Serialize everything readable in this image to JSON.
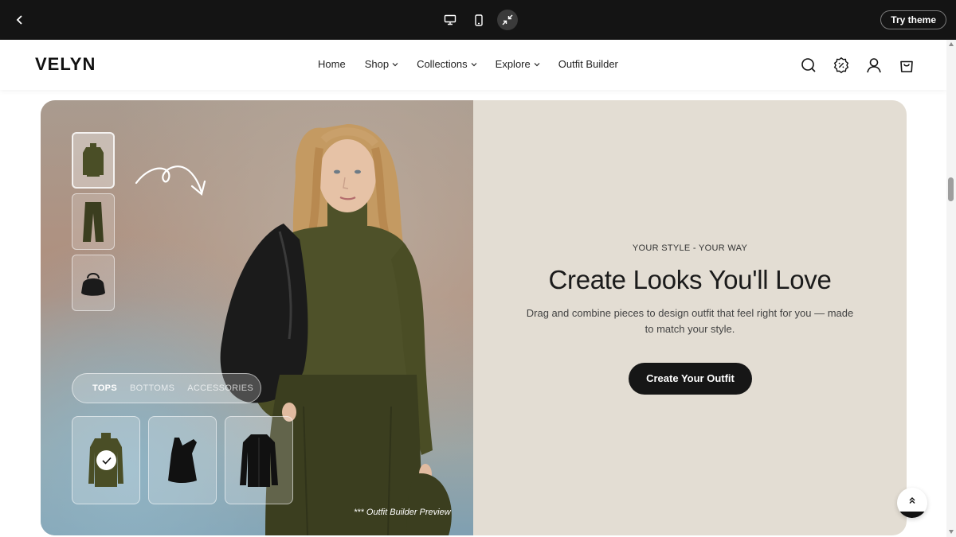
{
  "preview_bar": {
    "try_theme_label": "Try theme",
    "devices": [
      "desktop-icon",
      "mobile-icon",
      "fullscreen-exit-icon"
    ]
  },
  "header": {
    "logo": "VELYN",
    "nav": [
      {
        "label": "Home",
        "dropdown": false
      },
      {
        "label": "Shop",
        "dropdown": true
      },
      {
        "label": "Collections",
        "dropdown": true
      },
      {
        "label": "Explore",
        "dropdown": true
      },
      {
        "label": "Outfit Builder",
        "dropdown": false
      }
    ],
    "icons": [
      "search-icon",
      "discount-badge-icon",
      "account-icon",
      "cart-icon"
    ]
  },
  "builder": {
    "tabs": [
      {
        "label": "TOPS",
        "active": true
      },
      {
        "label": "BOTTOMS",
        "active": false
      },
      {
        "label": "ACCESSORIES",
        "active": false
      }
    ],
    "thumbnails": [
      "turtleneck-top",
      "wide-leg-pants",
      "leather-bag"
    ],
    "products": [
      "olive-turtleneck",
      "black-one-shoulder-top",
      "black-cardigan"
    ],
    "selected_product": "olive-turtleneck",
    "preview_note": "*** Outfit Builder Preview"
  },
  "hero": {
    "eyebrow": "YOUR STYLE - YOUR WAY",
    "headline": "Create Looks You'll Love",
    "description": "Drag and combine pieces to design outfit that feel right for you — made to match your style.",
    "cta_label": "Create Your Outfit"
  },
  "colors": {
    "top_bar": "#141414",
    "hero_panel": "#e3ddd3",
    "cta": "#161616",
    "olive": "#4a4e26"
  }
}
